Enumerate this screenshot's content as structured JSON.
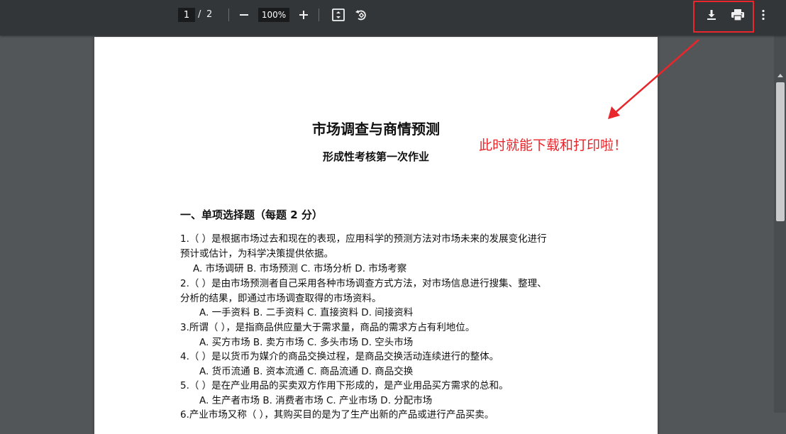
{
  "toolbar": {
    "page_current": "1",
    "page_separator": "/",
    "page_total": "2",
    "zoom_value": "100%"
  },
  "document": {
    "title": "市场调查与商情预测",
    "subtitle": "形成性考核第一次作业",
    "section_heading": "一、单项选择题（每题 2 分）",
    "lines": [
      "1.（ ）是根据市场过去和现在的表现，应用科学的预测方法对市场未来的发展变化进行",
      "预计或估计，为科学决策提供依据。",
      "A. 市场调研  B. 市场预测  C. 市场分析  D. 市场考察",
      "2.（ ）是由市场预测者自己采用各种市场调查方式方法，对市场信息进行搜集、整理、",
      "分析的结果，即通过市场调查取得的市场资料。",
      "A. 一手资料  B. 二手资料  C. 直接资料  D. 间接资料",
      "3.所谓（ ），是指商品供应量大于需求量，商品的需求方占有利地位。",
      "A. 买方市场  B. 卖方市场  C. 多头市场  D. 空头市场",
      "4.（ ）是以货币为媒介的商品交换过程，是商品交换活动连续进行的整体。",
      "A. 货币流通  B. 资本流通  C. 商品流通  D. 商品交换",
      "5.（ ）是在产业用品的买卖双方作用下形成的，是产业用品买方需求的总和。",
      "A. 生产者市场 B. 消费者市场 C. 产业市场  D. 分配市场",
      "6.产业市场又称（ ），其购买目的是为了生产出新的产品或进行产品买卖。"
    ]
  },
  "annotation": {
    "text": "此时就能下载和打印啦！",
    "color": "#e8262b"
  },
  "icons": [
    "minus-icon",
    "plus-icon",
    "fit-page-icon",
    "rotate-icon",
    "download-icon",
    "print-icon",
    "more-vert-icon"
  ]
}
